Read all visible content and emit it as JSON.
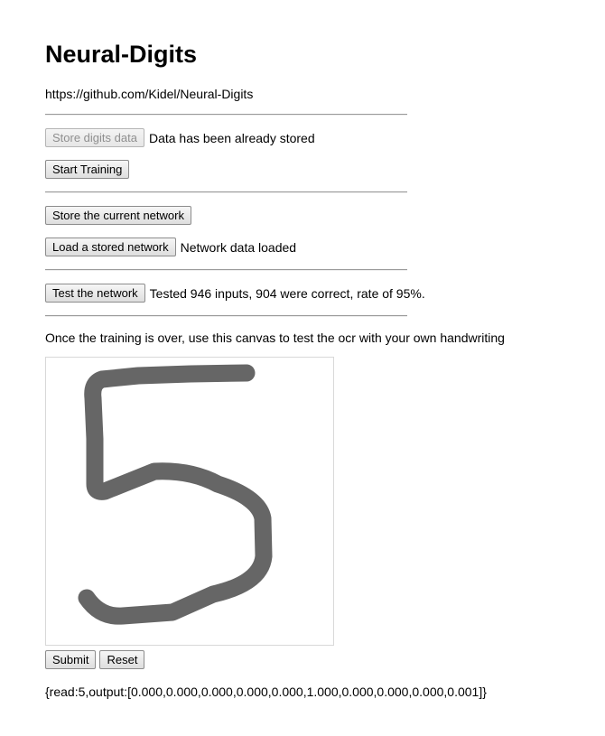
{
  "header": {
    "title": "Neural-Digits",
    "repo_url": "https://github.com/Kidel/Neural-Digits"
  },
  "data_section": {
    "store_digits_label": "Store digits data",
    "store_digits_status": "Data has been already stored",
    "start_training_label": "Start Training"
  },
  "network_section": {
    "store_network_label": "Store the current network",
    "load_network_label": "Load a stored network",
    "load_network_status": "Network data loaded"
  },
  "test_section": {
    "test_network_label": "Test the network",
    "test_result": "Tested 946 inputs, 904 were correct, rate of 95%."
  },
  "canvas_section": {
    "instructions": "Once the training is over, use this canvas to test the ocr with your own handwriting",
    "drawn_digit": "5",
    "stroke_color": "#666666",
    "submit_label": "Submit",
    "reset_label": "Reset",
    "result_output": "{read:5,output:[0.000,0.000,0.000,0.000,0.000,1.000,0.000,0.000,0.000,0.001]}"
  }
}
